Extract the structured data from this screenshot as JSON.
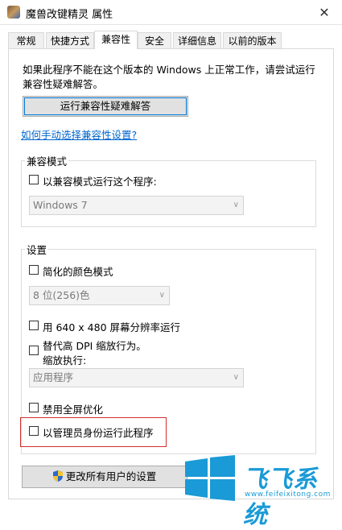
{
  "window": {
    "title": "魔兽改键精灵 属性",
    "close_glyph": "✕"
  },
  "tabs": [
    {
      "label": "常规",
      "active": false
    },
    {
      "label": "快捷方式",
      "active": false
    },
    {
      "label": "兼容性",
      "active": true
    },
    {
      "label": "安全",
      "active": false
    },
    {
      "label": "详细信息",
      "active": false
    },
    {
      "label": "以前的版本",
      "active": false
    }
  ],
  "compat": {
    "intro": "如果此程序不能在这个版本的 Windows 上正常工作，请尝试运行兼容性疑难解答。",
    "troubleshoot_button": "运行兼容性疑难解答",
    "manual_link": "如何手动选择兼容性设置?"
  },
  "compat_mode": {
    "group_label": "兼容模式",
    "checkbox_label": "以兼容模式运行这个程序:",
    "checked": false,
    "os_select": "Windows 7"
  },
  "settings": {
    "group_label": "设置",
    "reduced_color": {
      "label": "简化的颜色模式",
      "checked": false
    },
    "color_select": "8 位(256)色",
    "res_640": {
      "label": "用 640 x 480 屏幕分辨率运行",
      "checked": false
    },
    "dpi": {
      "label_line1": "替代高 DPI 缩放行为。",
      "label_line2": "缩放执行:",
      "checked": false
    },
    "dpi_select": "应用程序",
    "fullscreen_opt": {
      "label": "禁用全屏优化",
      "checked": false
    },
    "run_as_admin": {
      "label": "以管理员身份运行此程序",
      "checked": false
    }
  },
  "footer": {
    "all_users_button": "更改所有用户的设置"
  },
  "watermark": {
    "text": "飞飞系统",
    "url": "www.feifeixitong.com"
  },
  "colors": {
    "link": "#0066cc",
    "highlight_border": "#d32f2f",
    "watermark": "#1a9ad6"
  }
}
